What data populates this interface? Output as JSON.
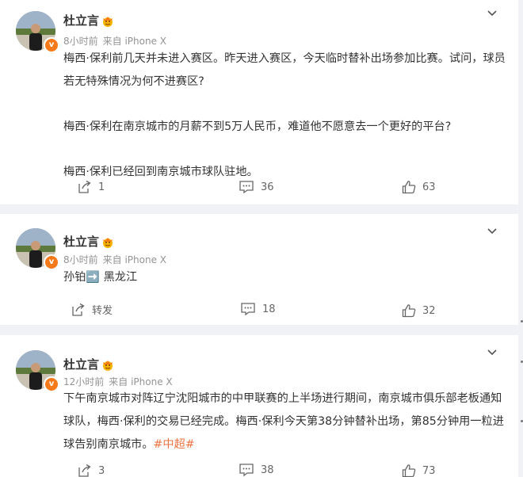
{
  "posts": [
    {
      "author": "杜立言",
      "time": "8小时前",
      "source": "来自 iPhone X",
      "paragraphs": [
        "梅西·保利前几天并未进入赛区。昨天进入赛区，今天临时替补出场参加比赛。试问，球员若无特殊情况为何不进赛区?",
        "梅西·保利在南京城市的月薪不到5万人民币，难道他不愿意去一个更好的平台?",
        "梅西·保利已经回到南京城市球队驻地。"
      ],
      "reposts": "1",
      "comments": "36",
      "likes": "63"
    },
    {
      "author": "杜立言",
      "time": "8小时前",
      "source": "来自 iPhone X",
      "text_before": "孙铂",
      "arrow": "➡️",
      "text_after": " 黑龙江",
      "reposts": "转发",
      "comments": "18",
      "likes": "32"
    },
    {
      "author": "杜立言",
      "time": "12小时前",
      "source": "来自 iPhone X",
      "text": "下午南京城市对阵辽宁沈阳城市的中甲联赛的上半场进行期间，南京城市俱乐部老板通知球队，梅西·保利的交易已经完成。梅西·保利今天第38分钟替补出场，第85分钟用一粒进球告别南京城市。",
      "hashtag": "#中超#",
      "reposts": "3",
      "comments": "38",
      "likes": "73"
    }
  ],
  "verified_mark": "v",
  "colors": {
    "accent": "#ff8200",
    "hashtag": "#eb7340",
    "meta": "#939393",
    "background": "#f1f2f5"
  }
}
